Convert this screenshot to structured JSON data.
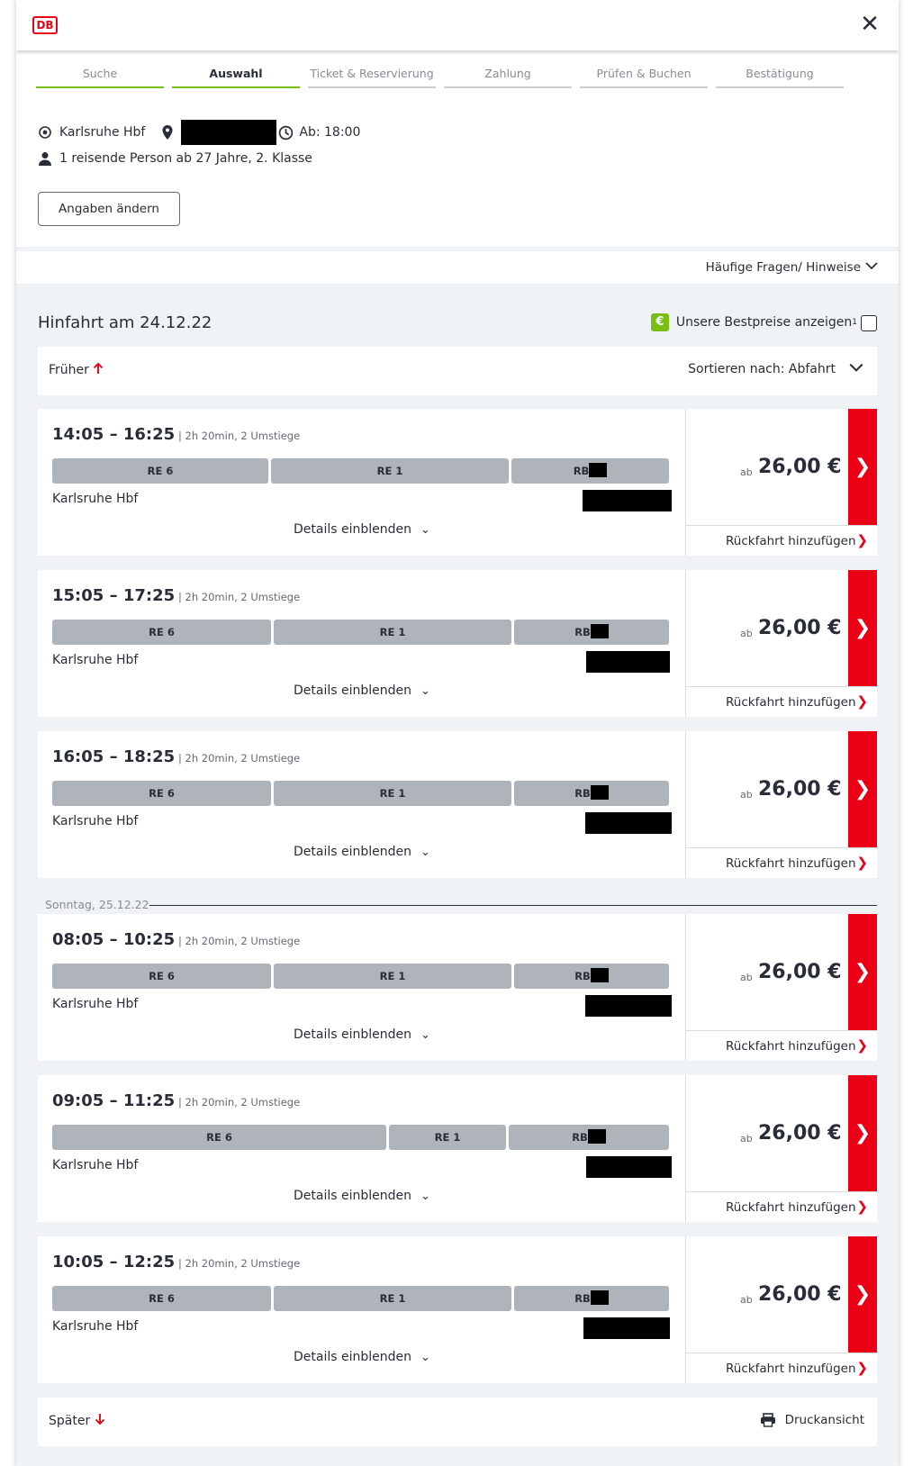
{
  "header": {
    "logo": "DB",
    "close": "✕"
  },
  "steps": [
    "Suche",
    "Auswahl",
    "Ticket & Reservierung",
    "Zahlung",
    "Prüfen & Buchen",
    "Bestätigung"
  ],
  "summary": {
    "origin": "Karlsruhe Hbf",
    "departure": "Ab: 18:00",
    "passenger": "1 reisende Person ab 27 Jahre, 2. Klasse",
    "change_button": "Angaben ändern"
  },
  "faq": "Häufige Fragen/ Hinweise",
  "outbound_title": "Hinfahrt am 24.12.22",
  "bestprice": {
    "label": "Unsere Bestpreise anzeigen",
    "sup": "1",
    "icon": "€"
  },
  "earlier": "Früher",
  "sort": "Sortieren nach: Abfahrt",
  "later": "Später",
  "print": "Druckansicht",
  "day_separator": "Sonntag, 25.12.22",
  "connections": [
    {
      "time": "14:05 – 16:25",
      "meta": "| 2h 20min, 2 Umstiege",
      "segments": [
        "RE 6",
        "RE 1",
        "RB"
      ],
      "origin": "Karlsruhe Hbf",
      "details": "Details einblenden",
      "ab": "ab",
      "price": "26,00 €",
      "return": "Rückfahrt hinzufügen"
    },
    {
      "time": "15:05 – 17:25",
      "meta": "| 2h 20min, 2 Umstiege",
      "segments": [
        "RE 6",
        "RE 1",
        "RB"
      ],
      "origin": "Karlsruhe Hbf",
      "details": "Details einblenden",
      "ab": "ab",
      "price": "26,00 €",
      "return": "Rückfahrt hinzufügen"
    },
    {
      "time": "16:05 – 18:25",
      "meta": "| 2h 20min, 2 Umstiege",
      "segments": [
        "RE 6",
        "RE 1",
        "RB"
      ],
      "origin": "Karlsruhe Hbf",
      "details": "Details einblenden",
      "ab": "ab",
      "price": "26,00 €",
      "return": "Rückfahrt hinzufügen"
    },
    {
      "time": "08:05 – 10:25",
      "meta": "| 2h 20min, 2 Umstiege",
      "segments": [
        "RE 6",
        "RE 1",
        "RB"
      ],
      "origin": "Karlsruhe Hbf",
      "details": "Details einblenden",
      "ab": "ab",
      "price": "26,00 €",
      "return": "Rückfahrt hinzufügen"
    },
    {
      "time": "09:05 – 11:25",
      "meta": "| 2h 20min, 2 Umstiege",
      "segments": [
        "RE 6",
        "RE 1",
        "RB"
      ],
      "origin": "Karlsruhe Hbf",
      "details": "Details einblenden",
      "ab": "ab",
      "price": "26,00 €",
      "return": "Rückfahrt hinzufügen"
    },
    {
      "time": "10:05 – 12:25",
      "meta": "| 2h 20min, 2 Umstiege",
      "segments": [
        "RE 6",
        "RE 1",
        "RB"
      ],
      "origin": "Karlsruhe Hbf",
      "details": "Details einblenden",
      "ab": "ab",
      "price": "26,00 €",
      "return": "Rückfahrt hinzufügen"
    }
  ],
  "colors": {
    "brand_red": "#ec0016",
    "progress_green": "#78be14",
    "segment_grey": "#afb4bb",
    "background": "#f0f3f5"
  }
}
